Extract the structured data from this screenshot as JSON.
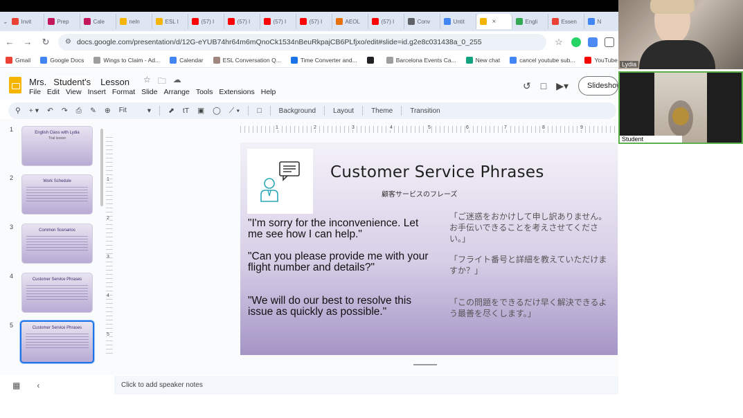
{
  "browser": {
    "tabs": [
      {
        "label": "Invit",
        "color": "#ea4335"
      },
      {
        "label": "Prep",
        "color": "#c2185b"
      },
      {
        "label": "Cale",
        "color": "#c2185b"
      },
      {
        "label": "neln",
        "color": "#f4b400"
      },
      {
        "label": "ESL I",
        "color": "#f4b400"
      },
      {
        "label": "(57) I",
        "color": "#ff0000"
      },
      {
        "label": "(57) I",
        "color": "#ff0000"
      },
      {
        "label": "(57) I",
        "color": "#ff0000"
      },
      {
        "label": "(57) I",
        "color": "#ff0000"
      },
      {
        "label": "AEOL",
        "color": "#e8710a"
      },
      {
        "label": "(57) I",
        "color": "#ff0000"
      },
      {
        "label": "Conv",
        "color": "#5f6368"
      },
      {
        "label": "Untit",
        "color": "#4285f4"
      },
      {
        "label": "",
        "color": "#f4b400",
        "active": true
      },
      {
        "label": "Engli",
        "color": "#34a853"
      },
      {
        "label": "Essen",
        "color": "#ea4335"
      },
      {
        "label": "N",
        "color": "#4285f4"
      }
    ],
    "url": "docs.google.com/presentation/d/12G-eYUB74hr64m6mQnoCk1534nBeuRkpajCB6PLfjxo/edit#slide=id.g2e8c031438a_0_255",
    "bookmarks": [
      {
        "label": "Gmail",
        "color": "#ea4335"
      },
      {
        "label": "Google Docs",
        "color": "#4285f4"
      },
      {
        "label": "Wings to Claim - Ad...",
        "color": "#9e9e9e"
      },
      {
        "label": "Calendar",
        "color": "#4285f4"
      },
      {
        "label": "ESL Conversation Q...",
        "color": "#a1887f"
      },
      {
        "label": "Time Converter and...",
        "color": "#1a73e8"
      },
      {
        "label": "",
        "color": "#202124"
      },
      {
        "label": "Barcelona Events Ca...",
        "color": "#9e9e9e"
      },
      {
        "label": "New chat",
        "color": "#10a37f"
      },
      {
        "label": "cancel youtube sub...",
        "color": "#4285f4"
      },
      {
        "label": "YouTube",
        "color": "#ff0000"
      }
    ]
  },
  "doc": {
    "title_part1": "Mrs.",
    "title_part2": "Student's",
    "title_part3": "Lesson",
    "menu": [
      "File",
      "Edit",
      "View",
      "Insert",
      "Format",
      "Slide",
      "Arrange",
      "Tools",
      "Extensions",
      "Help"
    ],
    "slideshow_label": "Slideshow"
  },
  "toolbar": {
    "zoom": "Fit",
    "background": "Background",
    "layout": "Layout",
    "theme": "Theme",
    "transition": "Transition"
  },
  "filmstrip": [
    {
      "num": "1",
      "title": "English Class with Lydia",
      "subtitle": "Trial lesson"
    },
    {
      "num": "2",
      "title": "Work Schedule",
      "subtitle": ""
    },
    {
      "num": "3",
      "title": "Common Scenarios",
      "subtitle": ""
    },
    {
      "num": "4",
      "title": "Customer Service Phrases",
      "subtitle": ""
    },
    {
      "num": "5",
      "title": "Customer Service Phrases",
      "subtitle": "",
      "selected": true
    }
  ],
  "ruler": {
    "top": [
      "1",
      "2",
      "3",
      "4",
      "5",
      "6",
      "7",
      "8",
      "9"
    ],
    "left": [
      "1",
      "2",
      "3",
      "4",
      "5"
    ]
  },
  "slide": {
    "title": "Customer Service Phrases",
    "subtitle": "顧客サービスのフレーズ",
    "phrases": [
      {
        "en_line1": "\"I'm sorry for the inconvenience. Let",
        "en_line2": "me see how I can help.\"",
        "jp": "「ご迷惑をおかけして申し訳ありません。お手伝いできることを考えさせてください。」"
      },
      {
        "en_line1": "\"Can you please provide me with your",
        "en_line2": "flight number and details?\"",
        "jp": "「フライト番号と詳細を教えていただけますか？」"
      },
      {
        "en_line1": "\"We will do our best to resolve this",
        "en_line2": "issue as quickly as possible.\"",
        "jp": "「この問題をできるだけ早く解決できるよう最善を尽くします。」"
      }
    ]
  },
  "notes": {
    "placeholder": "Click to add speaker notes"
  },
  "video": {
    "teacher_name": "Lydia",
    "student_name": "Student"
  }
}
